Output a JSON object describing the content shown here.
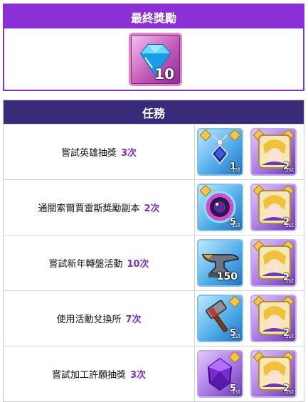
{
  "final_reward": {
    "title": "最終獎勵",
    "item": {
      "icon": "diamond-icon",
      "quantity": "10"
    }
  },
  "missions": {
    "title": "任務",
    "rows": [
      {
        "text": "嘗試英雄抽獎",
        "count": "3次",
        "rewards": [
          {
            "icon": "amulet-icon",
            "quantity": "1",
            "tier_label": "1st"
          },
          {
            "icon": "hero-portrait-icon",
            "quantity": "2",
            "tier_label": "1st"
          }
        ]
      },
      {
        "text": "通關索爾賈雷斯獎勵副本",
        "count": "2次",
        "rewards": [
          {
            "icon": "magic-orb-icon",
            "quantity": "5",
            "tier_label": "1st"
          },
          {
            "icon": "hero-portrait-icon",
            "quantity": "2",
            "tier_label": "1st"
          }
        ]
      },
      {
        "text": "嘗試新年轉盤活動",
        "count": "10次",
        "rewards": [
          {
            "icon": "anvil-icon",
            "quantity": "150",
            "tier_label": ""
          },
          {
            "icon": "hero-portrait-icon",
            "quantity": "2",
            "tier_label": "1st"
          }
        ]
      },
      {
        "text": "使用活動兌換所",
        "count": "7次",
        "rewards": [
          {
            "icon": "hammer-icon",
            "quantity": "5",
            "tier_label": "1st"
          },
          {
            "icon": "hero-portrait-icon",
            "quantity": "2",
            "tier_label": "1st"
          }
        ]
      },
      {
        "text": "嘗試加工許願抽獎",
        "count": "3次",
        "rewards": [
          {
            "icon": "purple-gem-icon",
            "quantity": "5",
            "tier_label": "1st"
          },
          {
            "icon": "hero-portrait-icon",
            "quantity": "2",
            "tier_label": "1st"
          }
        ]
      }
    ]
  },
  "colors": {
    "accent_purple": "#8b2fd6",
    "header_dark": "#3b2a7a",
    "count_purple": "#7b2fd0"
  }
}
